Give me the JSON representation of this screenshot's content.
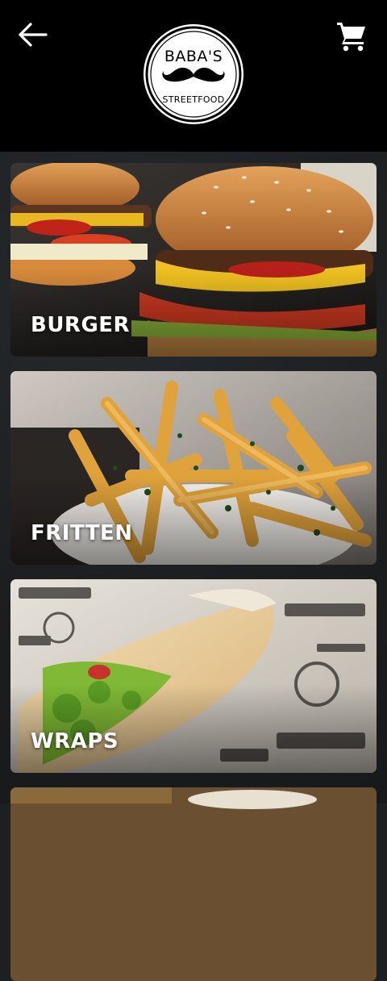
{
  "header": {
    "back_icon": "arrow-left-icon",
    "cart_icon": "shopping-cart-icon",
    "logo": {
      "name": "BABA'S",
      "tagline": "STREETFOOD"
    }
  },
  "categories": [
    {
      "label": "BURGER"
    },
    {
      "label": "FRITTEN"
    },
    {
      "label": "WRAPS"
    }
  ],
  "colors": {
    "header_bg": "#000000",
    "body_bg": "#1d2022",
    "label_text": "#ffffff"
  }
}
